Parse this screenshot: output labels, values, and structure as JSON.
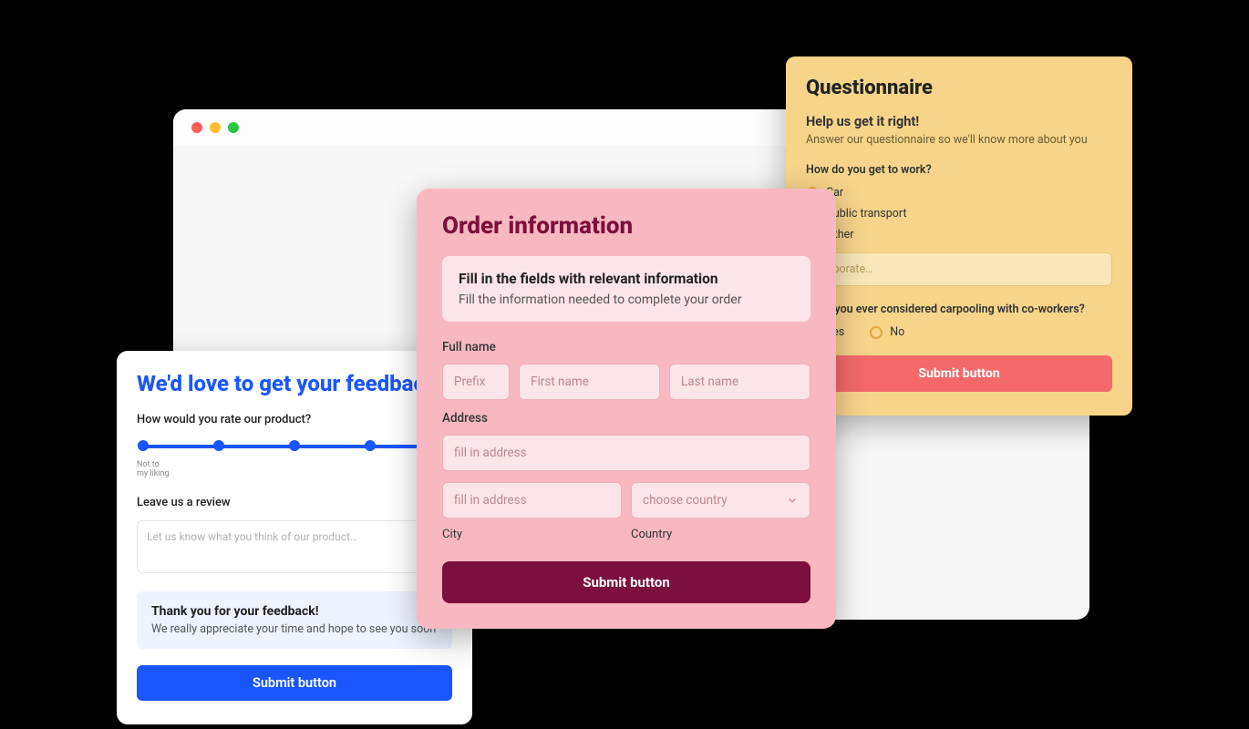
{
  "browser": {
    "traffic_colors": {
      "red": "#ff5f57",
      "yellow": "#febc2e",
      "green": "#28c840"
    }
  },
  "feedback": {
    "title": "We'd love to get your feedback",
    "q_rate": "How would you rate our product?",
    "slider_low_label": "Not to\nmy liking",
    "review_label": "Leave us a review",
    "review_placeholder": "Let us know what you think of our product…",
    "thank_title": "Thank you for your feedback!",
    "thank_sub": "We really appreciate your time and hope to see you soon",
    "submit": "Submit button"
  },
  "order": {
    "title": "Order information",
    "box_title": "Fill in the fields with relevant information",
    "box_sub": "Fill the information needed to complete your order",
    "fullname_label": "Full name",
    "prefix_ph": "Prefix",
    "first_ph": "First name",
    "last_ph": "Last name",
    "address_label": "Address",
    "address_ph": "fill in address",
    "city_ph": "fill in address",
    "country_ph": "choose country",
    "city_label": "City",
    "country_label": "Country",
    "submit": "Submit button"
  },
  "quest": {
    "title": "Questionnaire",
    "sub_title": "Help us get it right!",
    "sub_desc": "Answer our questionnaire so we'll know more about you",
    "q1": "How do you get to work?",
    "q1_opts": [
      "Car",
      "Public transport",
      "Other"
    ],
    "elaborate_ph": "elaborate…",
    "q2": "Have you ever considered carpooling with co-workers?",
    "q2_yes": "Yes",
    "q2_no": "No",
    "submit": "Submit button"
  }
}
